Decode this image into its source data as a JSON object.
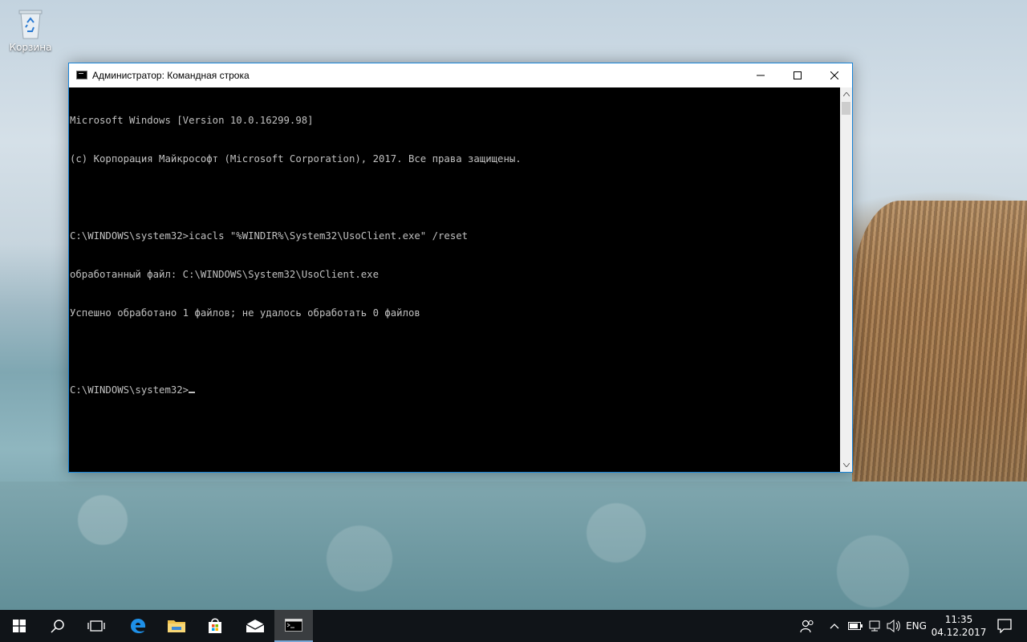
{
  "desktop": {
    "icons": [
      {
        "label": "Корзина",
        "icon": "recycle-bin-icon"
      }
    ]
  },
  "window": {
    "title": "Администратор: Командная строка",
    "controls": {
      "minimize": "minimize-icon",
      "maximize": "maximize-icon",
      "close": "close-icon"
    },
    "console": {
      "lines": [
        "Microsoft Windows [Version 10.0.16299.98]",
        "(c) Корпорация Майкрософт (Microsoft Corporation), 2017. Все права защищены.",
        "",
        "C:\\WINDOWS\\system32>icacls \"%WINDIR%\\System32\\UsoClient.exe\" /reset",
        "обработанный файл: C:\\WINDOWS\\System32\\UsoClient.exe",
        "Успешно обработано 1 файлов; не удалось обработать 0 файлов",
        "",
        "C:\\WINDOWS\\system32>"
      ]
    }
  },
  "taskbar": {
    "items": [
      "start-icon",
      "search-icon",
      "task-view-icon",
      "edge-icon",
      "file-explorer-icon",
      "store-icon",
      "mail-icon",
      "cmd-icon"
    ],
    "tray": {
      "language": "ENG",
      "time": "11:35",
      "date": "04.12.2017"
    }
  },
  "colors": {
    "console_bg": "#000000",
    "console_text": "#c0c0c0",
    "window_border": "#1883d7",
    "taskbar_bg": "#101418"
  }
}
